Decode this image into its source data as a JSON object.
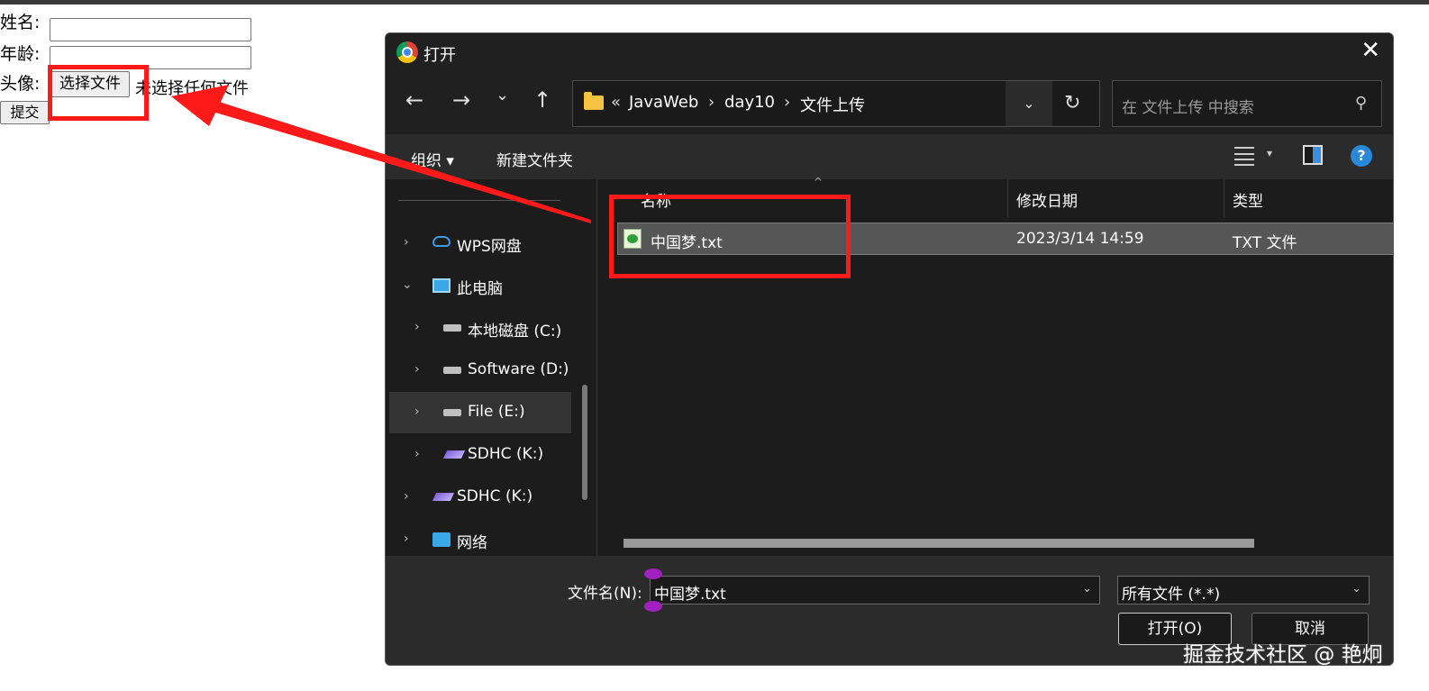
{
  "form": {
    "name_label": "姓名:",
    "age_label": "年龄:",
    "avatar_label": "头像:",
    "choose_file_button": "选择文件",
    "no_file_text": "未选择任何文件",
    "submit_button": "提交"
  },
  "dialog": {
    "title": "打开",
    "close_glyph": "✕",
    "nav": {
      "back": "←",
      "forward": "→",
      "recent": "⌄",
      "up": "↑",
      "breadcrumb_prefix": "«",
      "breadcrumb": [
        "JavaWeb",
        "day10",
        "文件上传"
      ],
      "separator": "›",
      "dropdown_glyph": "⌄",
      "refresh_glyph": "↻",
      "search_placeholder": "在 文件上传 中搜索",
      "search_glyph": "⚲"
    },
    "toolbar": {
      "organize": "组织 ▾",
      "new_folder": "新建文件夹",
      "view_dd": "▾",
      "help": "?"
    },
    "sidebar": [
      {
        "label": "WPS网盘",
        "icon": "cloud-icon",
        "chevron": "›"
      },
      {
        "label": "此电脑",
        "icon": "computer-icon",
        "chevron": "⌄"
      },
      {
        "label": "本地磁盘 (C:)",
        "icon": "drive-icon",
        "chevron": "›"
      },
      {
        "label": "Software (D:)",
        "icon": "drive-icon",
        "chevron": "›"
      },
      {
        "label": "File (E:)",
        "icon": "drive-icon",
        "chevron": "›"
      },
      {
        "label": "SDHC (K:)",
        "icon": "sd-card-icon",
        "chevron": "›"
      },
      {
        "label": "SDHC (K:)",
        "icon": "sd-card-icon",
        "chevron": "›"
      },
      {
        "label": "网络",
        "icon": "network-icon",
        "chevron": "›"
      }
    ],
    "columns": {
      "name": "名称",
      "modified": "修改日期",
      "type": "类型",
      "sort_glyph": "^"
    },
    "files": [
      {
        "name": "中国梦.txt",
        "modified": "2023/3/14 14:59",
        "type": "TXT 文件"
      }
    ],
    "bottom": {
      "filename_label": "文件名(N):",
      "filename_value": "中国梦.txt",
      "filetype_value": "所有文件 (*.*)",
      "dd_glyph": "⌄",
      "open_button": "打开(O)",
      "cancel_button": "取消"
    }
  },
  "watermark": "掘金技术社区 @ 艳炯",
  "colors": {
    "annotation": "#ff1a1a",
    "dialog_bg": "#1c1c1c",
    "selected_row": "#565656"
  }
}
